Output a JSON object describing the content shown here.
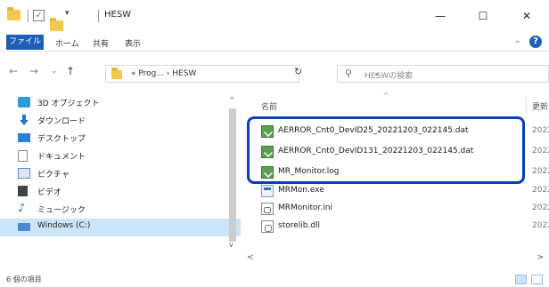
{
  "window": {
    "title": "HESW",
    "quick_access_arrow": "▾",
    "minimize": "—",
    "maximize": "☐",
    "close": "✕"
  },
  "ribbon": {
    "file_tab": "ファイル",
    "tabs": [
      "ホーム",
      "共有",
      "表示"
    ],
    "collapse": "⌄",
    "help": "?"
  },
  "nav": {
    "back": "←",
    "forward": "→",
    "recent": "⌄",
    "up": "↑",
    "address_text": "« Prog... › HESW",
    "address_chevron": "⌄",
    "refresh": "↻",
    "search_placeholder": "HESWの検索",
    "search_icon": "⚲"
  },
  "sidebar": {
    "items": [
      {
        "label": "3D オブジェクト",
        "icon": "cube-icon",
        "color": "#2e9ad8"
      },
      {
        "label": "ダウンロード",
        "icon": "download-icon",
        "color": "#2a6fd1"
      },
      {
        "label": "デスクトップ",
        "icon": "desktop-icon",
        "color": "#2a7fd8"
      },
      {
        "label": "ドキュメント",
        "icon": "document-icon",
        "color": "#8a8a8a"
      },
      {
        "label": "ピクチャ",
        "icon": "pictures-icon",
        "color": "#5b8bc9"
      },
      {
        "label": "ビデオ",
        "icon": "video-icon",
        "color": "#444444"
      },
      {
        "label": "ミュージック",
        "icon": "music-icon",
        "color": "#2a6fd1"
      },
      {
        "label": "Windows (C:)",
        "icon": "drive-icon",
        "color": "#4a8ad0",
        "selected": true
      }
    ],
    "scroll_up": "^",
    "scroll_down": "v"
  },
  "file_list": {
    "column_name": "名前",
    "column_date": "更新",
    "sort_indicator": "^",
    "rows": [
      {
        "name": "AERROR_Cnt0_DevID25_20221203_022145.dat",
        "date": "2022",
        "type": "dat"
      },
      {
        "name": "AERROR_Cnt0_DevID131_20221203_022145.dat",
        "date": "2022",
        "type": "dat"
      },
      {
        "name": "MR_Monitor.log",
        "date": "2022",
        "type": "dat"
      },
      {
        "name": "MRMon.exe",
        "date": "2022",
        "type": "exe"
      },
      {
        "name": "MRMonitor.ini",
        "date": "2022",
        "type": "ini"
      },
      {
        "name": "storelib.dll",
        "date": "2022",
        "type": "dll"
      }
    ],
    "scroll_left": "<",
    "scroll_right": ">"
  },
  "status_bar": {
    "item_count": "6 個の項目"
  },
  "colors": {
    "accent": "#1e5eb5",
    "highlight_border": "#0a3dbd",
    "selection": "#cce4f7"
  }
}
